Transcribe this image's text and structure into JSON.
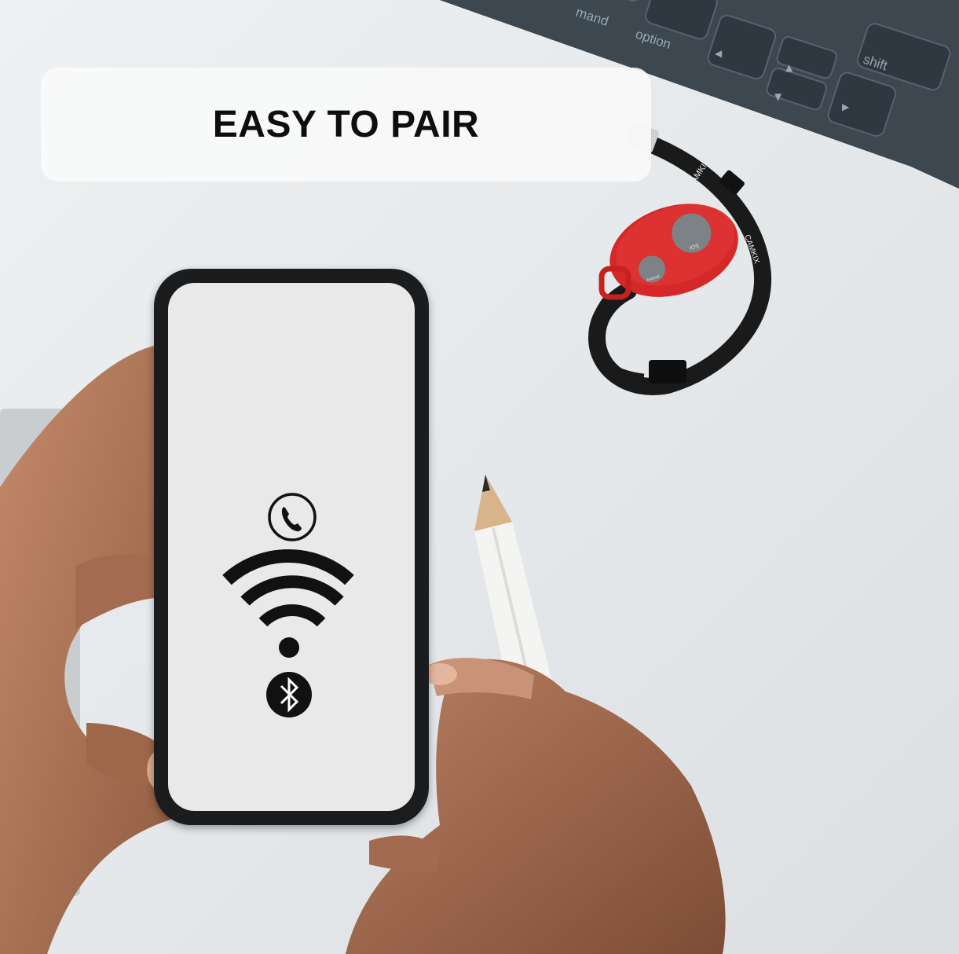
{
  "headline": {
    "text": "EASY TO PAIR"
  },
  "keyboard": {
    "keys": [
      {
        "label": "mand"
      },
      {
        "label": "option"
      },
      {
        "label": "shift"
      }
    ],
    "arrow_symbols": {
      "left": "◀",
      "up": "▲",
      "down": "▼",
      "right": "▶"
    }
  },
  "remote": {
    "brand": "CAMKIX",
    "button_labels": {
      "large": "IOS",
      "small": "Android"
    }
  },
  "phone_screen": {
    "icons": [
      "phone-call-icon",
      "wifi-icon",
      "bluetooth-icon"
    ]
  },
  "colors": {
    "background": "#e4e8ea",
    "keyboard": "#3c4750",
    "remote": "#d62828",
    "strap": "#1a1a1a",
    "phone_body": "#1b1c1e",
    "phone_screen": "#e9e9e9",
    "icon": "#111111",
    "skin": "#b07a5c"
  }
}
